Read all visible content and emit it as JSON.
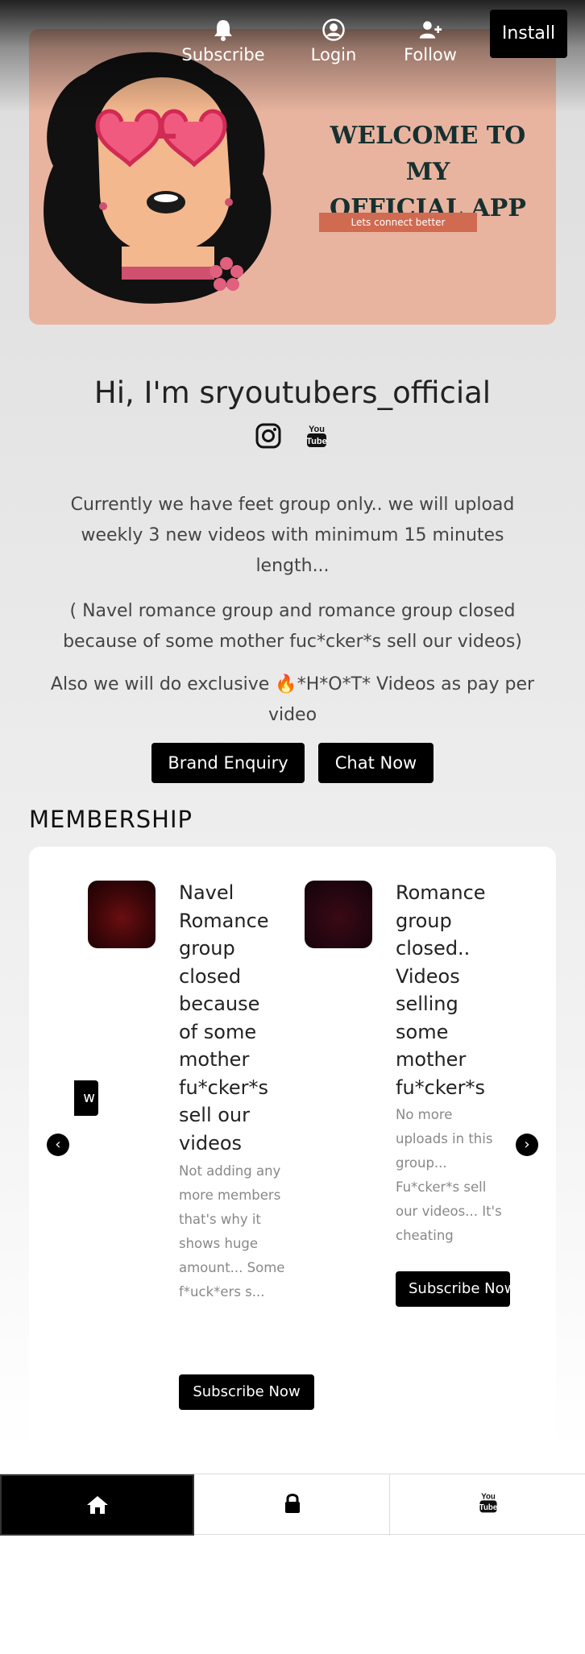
{
  "topnav": {
    "subscribe_label": "Subscribe",
    "login_label": "Login",
    "follow_label": "Follow",
    "install_label": "Install"
  },
  "banner": {
    "title_line1": "WELCOME TO MY",
    "title_line2": "OFFICIAL APP",
    "button_label": "Lets connect better"
  },
  "profile": {
    "greeting": "Hi, I'm sryoutubers_official",
    "social_icons": [
      "instagram-icon",
      "youtube-icon"
    ]
  },
  "description": {
    "para1": "Currently we have feet group only.. we will upload weekly 3 new videos with minimum 15 minutes length...",
    "para2": "( Navel romance group and romance group closed because of some mother fuc*cker*s sell our videos)",
    "para3_prefix": "Also we will do exclusive ",
    "para3_emoji": "🔥",
    "para3_suffix": "*H*O*T* Videos as pay per video"
  },
  "actions": {
    "brand_enquiry": "Brand Enquiry",
    "chat_now": "Chat Now"
  },
  "membership": {
    "heading": "MEMBERSHIP",
    "partial_button": "w",
    "prev_arrow": "‹",
    "next_arrow": "›",
    "cards": [
      {
        "title": "Navel Romance group closed because of some mother fu*cker*s sell our videos",
        "desc": "Not adding any more members that's why it shows huge amount... Some f*uck*ers s...",
        "button": "Subscribe Now"
      },
      {
        "title": "Romance group closed.. Videos selling some mother fu*cker*s",
        "desc": "No more uploads in this group... Fu*cker*s sell our videos... It's cheating",
        "button": "Subscribe Now"
      }
    ]
  },
  "bottom_tabs": [
    "home-icon",
    "lock-icon",
    "youtube-icon"
  ],
  "colors": {
    "banner_bg": "#e8b4a0",
    "banner_button": "#d06a50",
    "primary_button": "#000000",
    "banner_title": "#16302f"
  }
}
